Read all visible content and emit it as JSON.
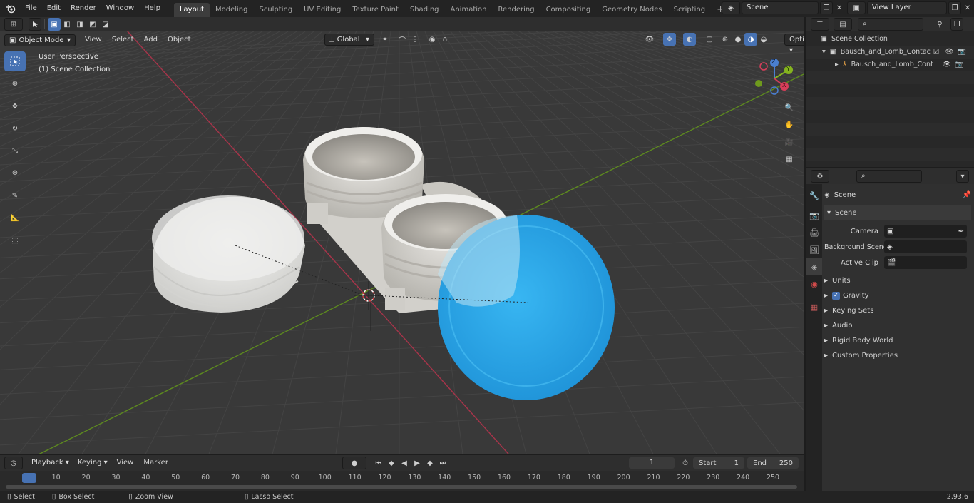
{
  "topbar": {
    "menus": [
      "File",
      "Edit",
      "Render",
      "Window",
      "Help"
    ],
    "workspaces": [
      "Layout",
      "Modeling",
      "Sculpting",
      "UV Editing",
      "Texture Paint",
      "Shading",
      "Animation",
      "Rendering",
      "Compositing",
      "Geometry Nodes",
      "Scripting"
    ],
    "active_workspace": "Layout",
    "add_workspace": "+",
    "scene_field": "Scene",
    "view_layer_field": "View Layer"
  },
  "viewport_header": {
    "mode": "Object Mode",
    "menus": [
      "View",
      "Select",
      "Add",
      "Object"
    ],
    "transform_orientation": "Global",
    "options": "Options"
  },
  "viewport": {
    "view_name": "User Perspective",
    "collection_info": "(1) Scene Collection",
    "gizmo_axes": {
      "x": "X",
      "y": "Y",
      "z": "Z"
    }
  },
  "outliner": {
    "root": "Scene Collection",
    "items": [
      {
        "label": "Bausch_and_Lomb_Contact_L",
        "type": "collection"
      },
      {
        "label": "Bausch_and_Lomb_Cont",
        "type": "object"
      }
    ]
  },
  "properties": {
    "context": "Scene",
    "panel_title": "Scene",
    "fields": [
      {
        "label": "Camera",
        "value": ""
      },
      {
        "label": "Background Scene",
        "value": ""
      },
      {
        "label": "Active Clip",
        "value": ""
      }
    ],
    "subpanels": [
      "Units",
      "Gravity",
      "Keying Sets",
      "Audio",
      "Rigid Body World",
      "Custom Properties"
    ],
    "gravity_checked": true
  },
  "timeline": {
    "menus": [
      "Playback",
      "Keying",
      "View",
      "Marker"
    ],
    "current_frame": "1",
    "start_label": "Start",
    "start_value": "1",
    "end_label": "End",
    "end_value": "250",
    "ticks": [
      "1",
      "10",
      "20",
      "30",
      "40",
      "50",
      "60",
      "70",
      "80",
      "90",
      "100",
      "110",
      "120",
      "130",
      "140",
      "150",
      "160",
      "170",
      "180",
      "190",
      "200",
      "210",
      "220",
      "230",
      "240",
      "250"
    ]
  },
  "statusbar": {
    "items": [
      "Select",
      "Box Select",
      "Zoom View",
      "Lasso Select"
    ],
    "version": "2.93.6"
  },
  "colors": {
    "accent": "#4772b3",
    "viewport_bg": "#393939",
    "x_axis": "#c0394a",
    "y_axis": "#6a9a23",
    "lid_blue": "#2aa7e8"
  }
}
